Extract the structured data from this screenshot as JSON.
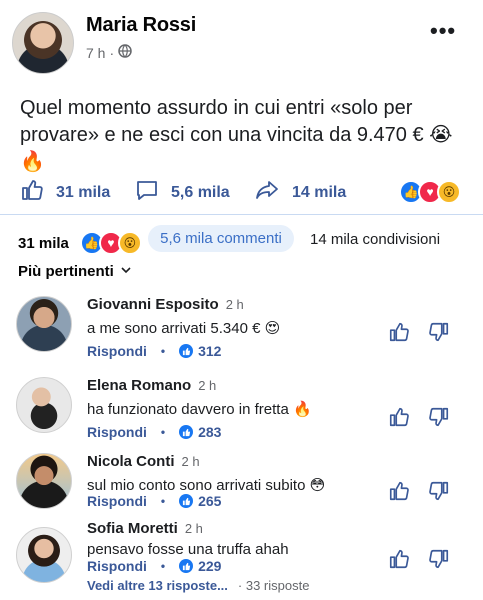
{
  "post": {
    "author": "Maria Rossi",
    "time": "7 h",
    "separator": "·",
    "text": "Quel momento assurdo in cui entri «solo per provare» e ne esci con una vincita da 9.470 € 😭🔥",
    "more_label": "•••"
  },
  "stats": {
    "likes": "31 mila",
    "comments": "5,6 mila",
    "shares": "14 mila"
  },
  "counts": {
    "reactions": "31 mila",
    "comments": "5,6 mila commenti",
    "shares": "14 mila condivisioni"
  },
  "filter": {
    "label": "Più pertinenti"
  },
  "comments": [
    {
      "name": "Giovanni Esposito",
      "time": "2 h",
      "text": "a me sono arrivati 5.340 € 😍",
      "reply": "Rispondi",
      "likes": "312"
    },
    {
      "name": "Elena Romano",
      "time": "2 h",
      "text": "ha funzionato davvero in fretta 🔥",
      "reply": "Rispondi",
      "likes": "283"
    },
    {
      "name": "Nicola Conti",
      "time": "2 h",
      "text": "sul mio conto sono arrivati subito 😳",
      "reply": "Rispondi",
      "likes": "265"
    },
    {
      "name": "Sofia Moretti",
      "time": "2 h",
      "text": "pensavo fosse una truffa ahah",
      "reply": "Rispondi",
      "likes": "229"
    }
  ],
  "more_replies": {
    "label": "Vedi altre 13 risposte...",
    "count": "· 33 risposte"
  },
  "colors": {
    "accent": "#1877f2",
    "link": "#3b5998",
    "love": "#f0284a",
    "wow": "#f7b928"
  }
}
